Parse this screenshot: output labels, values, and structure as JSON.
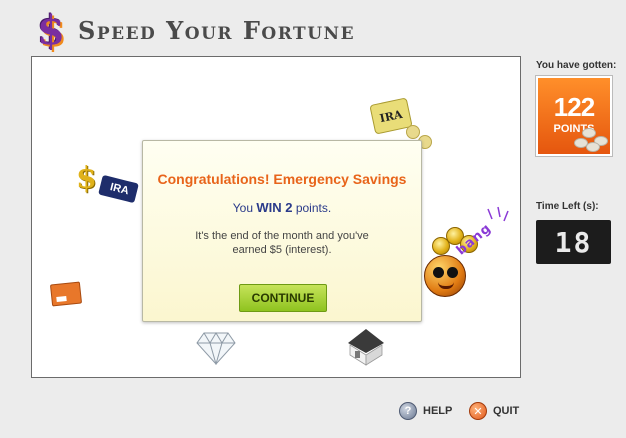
{
  "header": {
    "title": "Speed Your Fortune",
    "logo_glyph": "$"
  },
  "board": {
    "items": [
      {
        "name": "dollar-ira-tag-icon",
        "label": "IRA",
        "glyph": "$"
      },
      {
        "name": "ira-moneybag-icon",
        "label": "IRA"
      },
      {
        "name": "credit-card-icon"
      },
      {
        "name": "diamond-icon"
      },
      {
        "name": "house-icon"
      },
      {
        "name": "bomb-smiley-icon"
      },
      {
        "name": "gold-coins-icon"
      }
    ],
    "bang_text": "bang"
  },
  "dialog": {
    "title": "Congratulations! Emergency Savings",
    "win_prefix": "You ",
    "win_amount": "WIN 2",
    "win_suffix": " points.",
    "message": "It's the end of the month and you've earned $5 (interest).",
    "continue_label": "CONTINUE"
  },
  "score": {
    "label": "You have gotten:",
    "value": "122",
    "unit": "POINTS"
  },
  "timer": {
    "label": "Time Left (s):",
    "value": "18"
  },
  "footer": {
    "help_label": "HELP",
    "quit_label": "QUIT"
  },
  "colors": {
    "accent": "#e8641a",
    "score_bg": "#f5731b",
    "continue_bg": "#9ccb2a",
    "timer_bg": "#1c1c1c"
  }
}
